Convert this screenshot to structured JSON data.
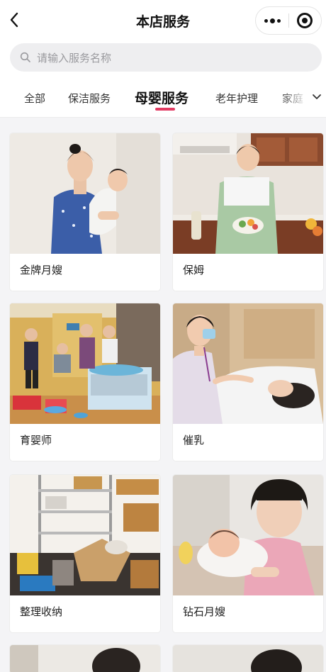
{
  "header": {
    "title": "本店服务",
    "back_icon": "chevron-left-icon",
    "more_icon": "ellipsis-icon",
    "close_icon": "record-circle-icon"
  },
  "search": {
    "placeholder": "请输入服务名称",
    "icon": "search-icon"
  },
  "tabs": [
    {
      "label": "全部",
      "active": false
    },
    {
      "label": "保洁服务",
      "active": false
    },
    {
      "label": "母婴服务",
      "active": true
    },
    {
      "label": "老年护理",
      "active": false
    },
    {
      "label": "家庭",
      "active": false
    }
  ],
  "tabs_more_icon": "chevron-down-icon",
  "colors": {
    "accent": "#e23b62",
    "background": "#f4f4f6"
  },
  "services": [
    {
      "name": "金牌月嫂"
    },
    {
      "name": "保姆"
    },
    {
      "name": "育婴师"
    },
    {
      "name": "催乳"
    },
    {
      "name": "整理收纳"
    },
    {
      "name": "钻石月嫂"
    }
  ]
}
